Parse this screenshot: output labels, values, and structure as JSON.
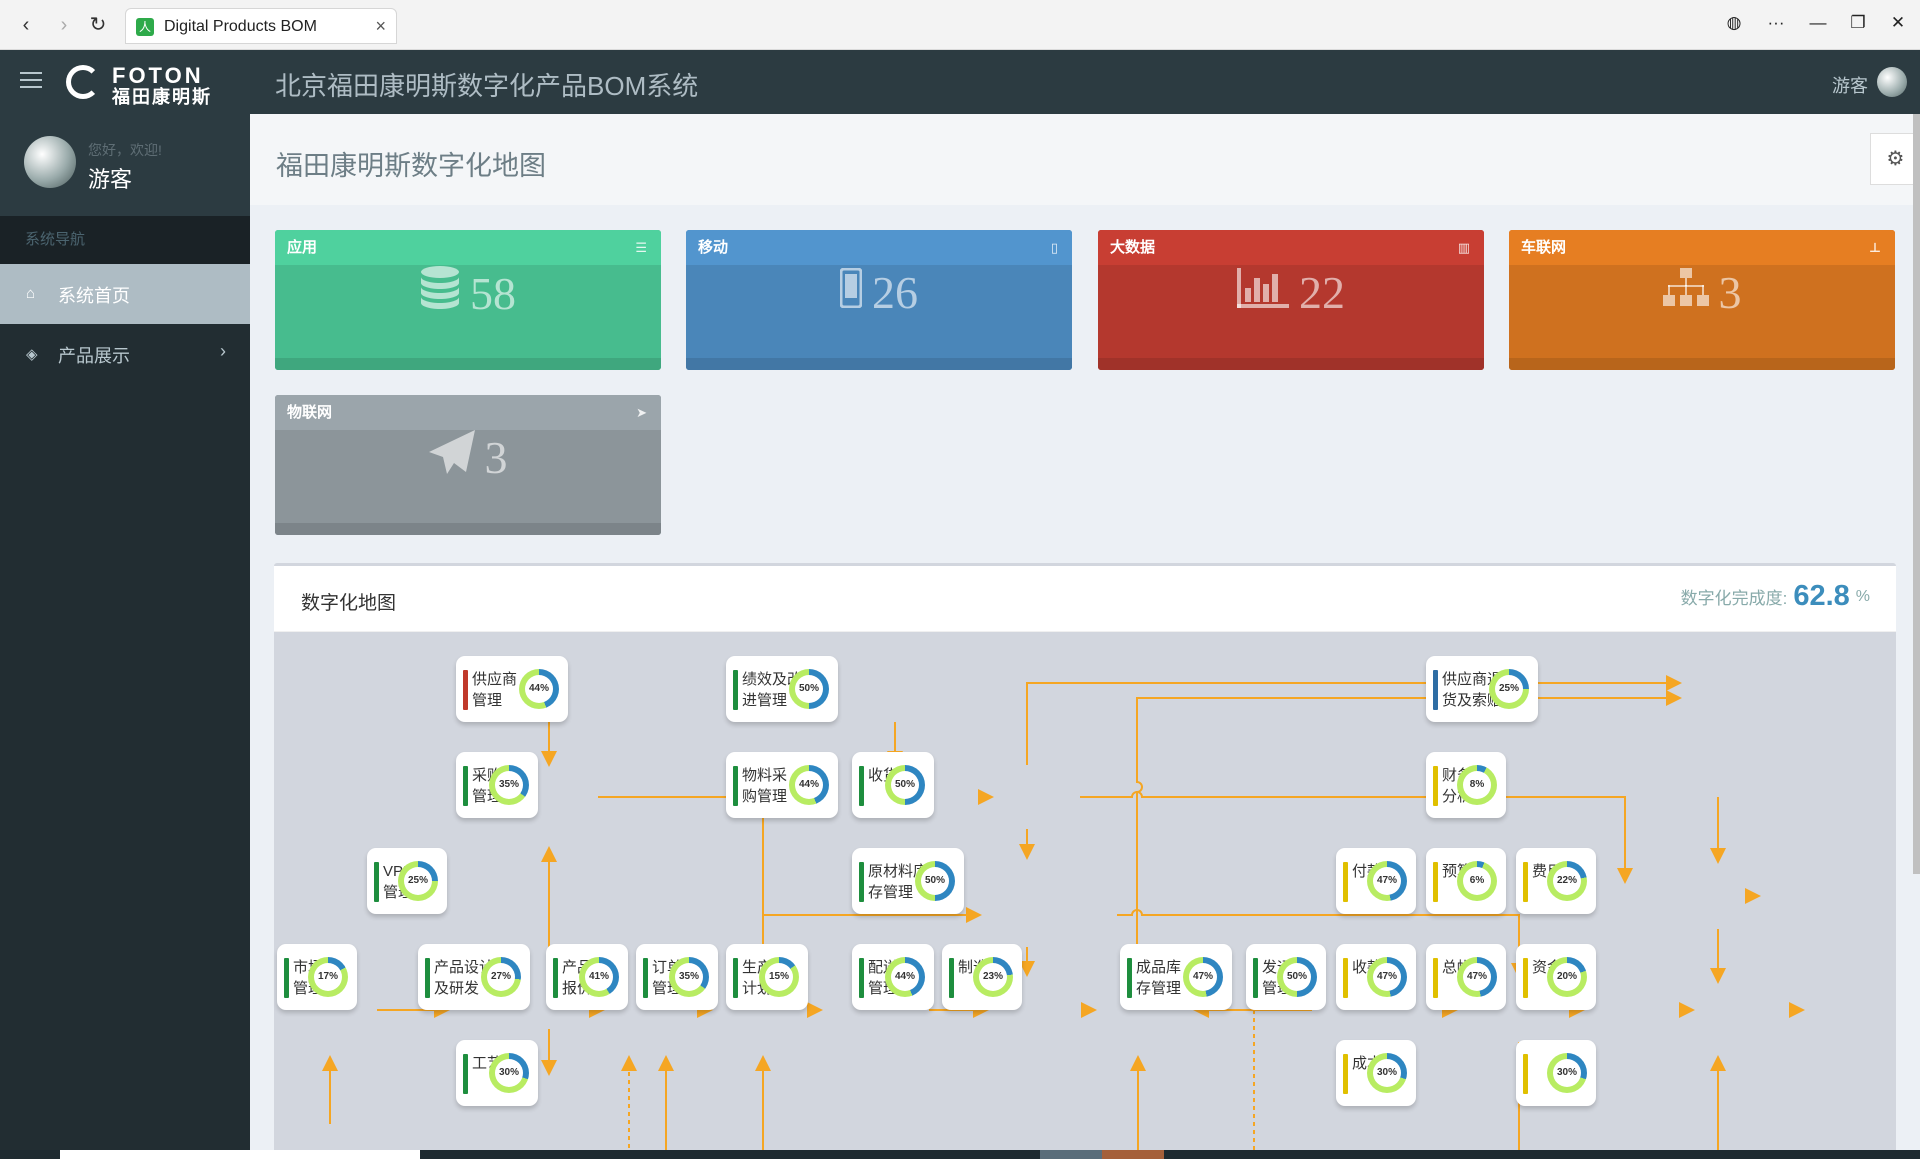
{
  "browser": {
    "tab_title": "Digital Products BOM",
    "favicon_label": "人",
    "back": "‹",
    "forward": "›",
    "reload": "↻",
    "tab_close": "×",
    "globe": "◍",
    "more": "···",
    "minimize": "—",
    "restore": "❐",
    "close": "✕"
  },
  "header": {
    "logo_en": "FOTON",
    "logo_cn": "福田康明斯",
    "system_title": "北京福田康明斯数字化产品BOM系统",
    "user": "游客"
  },
  "sidebar": {
    "greeting": "您好，欢迎!",
    "name": "游客",
    "nav_header": "系统导航",
    "items": [
      {
        "label": "系统首页",
        "icon": "home-icon",
        "active": true
      },
      {
        "label": "产品展示",
        "icon": "cube-icon",
        "active": false
      }
    ]
  },
  "page": {
    "title": "福田康明斯数字化地图"
  },
  "cards": [
    {
      "label": "应用",
      "value": "58",
      "icon": "database-icon",
      "color": "#4fd19e"
    },
    {
      "label": "移动",
      "value": "26",
      "icon": "mobile-icon",
      "color": "#5295ce"
    },
    {
      "label": "大数据",
      "value": "22",
      "icon": "bar-chart-icon",
      "color": "#c83e33"
    },
    {
      "label": "车联网",
      "value": "3",
      "icon": "sitemap-icon",
      "color": "#e67e22"
    },
    {
      "label": "物联网",
      "value": "3",
      "icon": "paper-plane-icon",
      "color": "#9ba5ab"
    }
  ],
  "map": {
    "title": "数字化地图",
    "completion_label": "数字化完成度:",
    "completion_value": "62.8",
    "completion_unit": "%",
    "nodes": [
      {
        "id": "supplier",
        "label": "供应商\n管理",
        "pct": 44,
        "status": "#c0392b"
      },
      {
        "id": "perf",
        "label": "绩效及改\n进管理",
        "pct": 50,
        "status": "#1e8e3e"
      },
      {
        "id": "return",
        "label": "供应商退\n货及索赔",
        "pct": 25,
        "status": "#2e6da4"
      },
      {
        "id": "purchase",
        "label": "采购\n管理",
        "pct": 35,
        "status": "#1e8e3e"
      },
      {
        "id": "matpur",
        "label": "物料采\n购管理",
        "pct": 44,
        "status": "#1e8e3e"
      },
      {
        "id": "receive",
        "label": "收货",
        "pct": 50,
        "status": "#1e8e3e"
      },
      {
        "id": "finance",
        "label": "财务\n分析",
        "pct": 8,
        "status": "#e0c000"
      },
      {
        "id": "vpi",
        "label": "VPI\n管理",
        "pct": 25,
        "status": "#1e8e3e"
      },
      {
        "id": "rawinv",
        "label": "原材料库\n存管理",
        "pct": 50,
        "status": "#1e8e3e"
      },
      {
        "id": "payment",
        "label": "付款",
        "pct": 47,
        "status": "#e0c000"
      },
      {
        "id": "budget",
        "label": "预算",
        "pct": 6,
        "status": "#e0c000"
      },
      {
        "id": "expense",
        "label": "费用",
        "pct": 22,
        "status": "#e0c000"
      },
      {
        "id": "market",
        "label": "市场\n管理",
        "pct": 17,
        "status": "#1e8e3e"
      },
      {
        "id": "design",
        "label": "产品设计\n及研发",
        "pct": 27,
        "status": "#1e8e3e"
      },
      {
        "id": "quote",
        "label": "产品\n报价",
        "pct": 41,
        "status": "#1e8e3e"
      },
      {
        "id": "order",
        "label": "订单\n管理",
        "pct": 35,
        "status": "#1e8e3e"
      },
      {
        "id": "plan",
        "label": "生产\n计划",
        "pct": 15,
        "status": "#1e8e3e"
      },
      {
        "id": "dist",
        "label": "配送\n管理",
        "pct": 44,
        "status": "#1e8e3e"
      },
      {
        "id": "mfg",
        "label": "制造",
        "pct": 23,
        "status": "#1e8e3e"
      },
      {
        "id": "fginv",
        "label": "成品库\n存管理",
        "pct": 47,
        "status": "#1e8e3e"
      },
      {
        "id": "ship",
        "label": "发运\n管理",
        "pct": 50,
        "status": "#1e8e3e"
      },
      {
        "id": "collect",
        "label": "收款",
        "pct": 47,
        "status": "#e0c000"
      },
      {
        "id": "ledger",
        "label": "总帐",
        "pct": 47,
        "status": "#e0c000"
      },
      {
        "id": "fund",
        "label": "资金",
        "pct": 20,
        "status": "#e0c000"
      },
      {
        "id": "process",
        "label": "工艺",
        "pct": 30,
        "status": "#1e8e3e"
      },
      {
        "id": "cost",
        "label": "成本",
        "pct": 30,
        "status": "#e0c000"
      },
      {
        "id": "extra",
        "label": "",
        "pct": 30,
        "status": "#e0c000"
      }
    ]
  },
  "colors": {
    "arrow": "#f5a623",
    "ring_track": "#b8ec62",
    "ring_fill": "#2e86c1"
  }
}
